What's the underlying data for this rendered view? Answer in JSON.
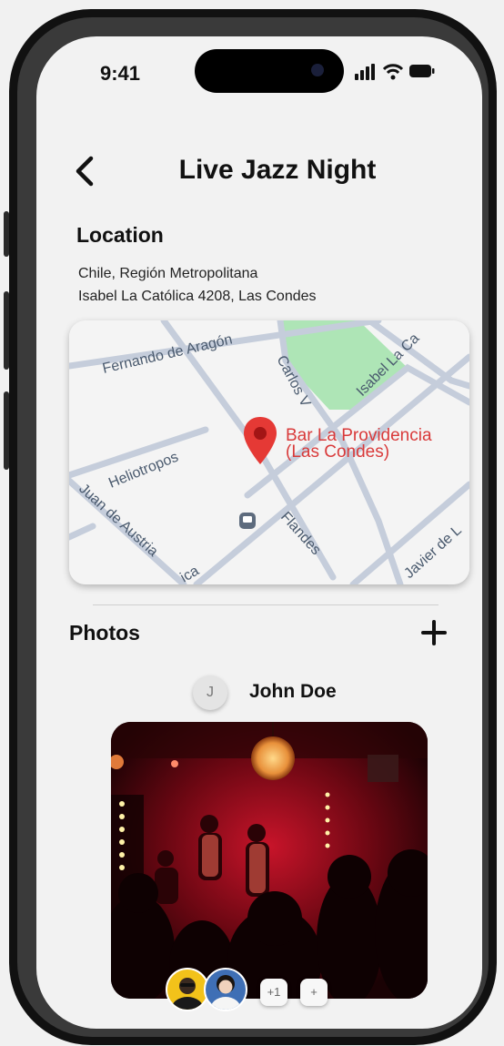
{
  "status_bar": {
    "time": "9:41"
  },
  "header": {
    "title": "Live Jazz Night"
  },
  "location": {
    "heading": "Location",
    "address_line1": "Chile, Región Metropolitana",
    "address_line2": "Isabel La Católica 4208, Las Condes"
  },
  "map": {
    "place_name_line1": "Bar La Providencia",
    "place_name_line2": "(Las Condes)",
    "streets": {
      "fernando": "Fernando de Aragón",
      "carlos": "Carlos V",
      "isabel": "Isabel La Ca",
      "heliotropos": "Heliotropos",
      "juan": "Juan de Austria",
      "flandes": "Flandes",
      "javier": "Javier de L",
      "ica": "ica"
    },
    "pin_color": "#e53935",
    "park_color": "#aee5b6"
  },
  "photos": {
    "heading": "Photos",
    "author_initial": "J",
    "author_name": "John Doe",
    "more_count": "+1",
    "add_label": "+"
  }
}
